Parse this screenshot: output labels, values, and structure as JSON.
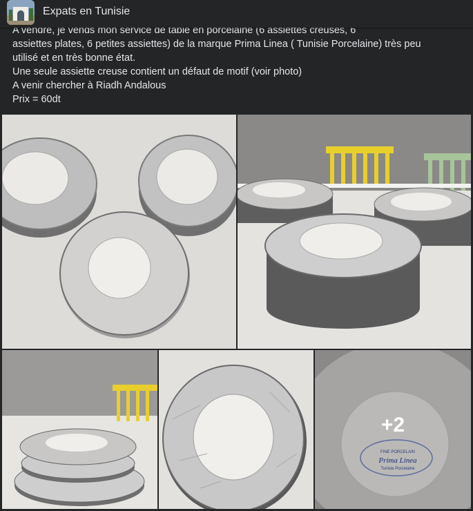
{
  "group": {
    "name": "Expats en Tunisie"
  },
  "post": {
    "lines": [
      "A vendre, je vends mon service de table en porcelaine (6 assiettes creuses, 6",
      "assiettes plates, 6 petites assiettes) de la marque Prima Linea ( Tunisie Porcelaine) très peu",
      "utilisé et en très bonne état.",
      "Une seule assiette creuse contient un défaut de motif (voir photo)",
      "A venir chercher à Riadh Andalous",
      "Prix = 60dt"
    ]
  },
  "photos": {
    "more_count": "+2",
    "stamp_line1": "FINE PORCELAIN",
    "stamp_brand": "Prima Linea",
    "stamp_line3": "Tunisie Porcelaine"
  },
  "colors": {
    "bg": "#242526",
    "text": "#e4e6eb",
    "plate_rim": "#bdbcbc",
    "plate_center": "#ececea",
    "chair_yellow": "#e8cf2b",
    "chair_green": "#a8c49a"
  }
}
